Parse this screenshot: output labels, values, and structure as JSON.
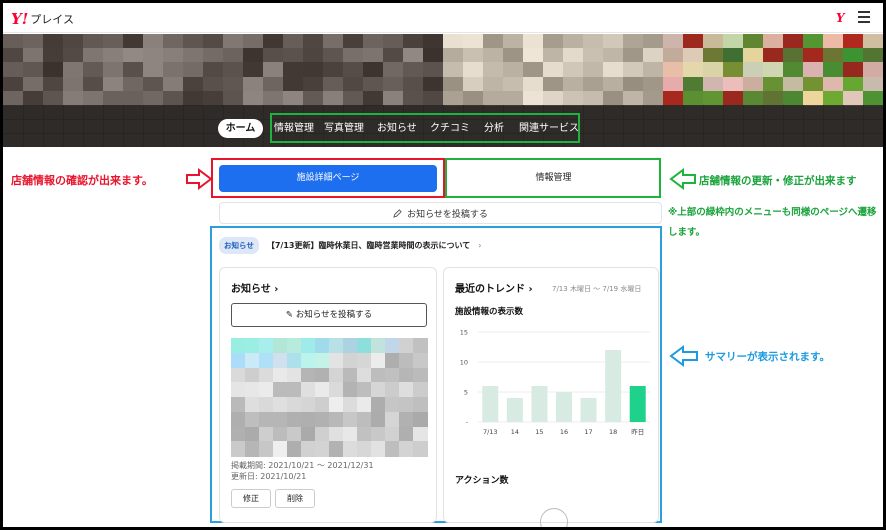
{
  "app": {
    "logo_mark": "Y!",
    "logo_name": "プレイス",
    "corner_logo": "Y"
  },
  "nav": {
    "home": "ホーム",
    "items": [
      "情報管理",
      "写真管理",
      "お知らせ",
      "クチコミ",
      "分析",
      "関連サービス"
    ]
  },
  "buttons": {
    "facility_page": "施設詳細ページ",
    "info_manage": "情報管理",
    "post_notice": "お知らせを投稿する"
  },
  "annotations": {
    "red_left": "店舗情報の確認が出来ます。",
    "green_right": "店舗情報の更新・修正が出来ます",
    "green_note": "※上部の緑枠内のメニューも同様のページへ遷移します。",
    "blue_right": "サマリーが表示されます。"
  },
  "notice": {
    "tag": "お知らせ",
    "title": "【7/13更新】臨時休業日、臨時営業時間の表示について",
    "chevron": "›"
  },
  "left_card": {
    "title": "お知らせ ›",
    "post_button": "お知らせを投稿する",
    "period": "掲載期間: 2021/10/21 ～ 2021/12/31",
    "updated": "更新日: 2021/10/21",
    "edit": "修正",
    "delete": "削除"
  },
  "right_card": {
    "title": "最近のトレンド ›",
    "date_range": "7/13 木曜日 ～ 7/19 水曜日",
    "chart_title": "施設情報の表示数",
    "action_title": "アクション数"
  },
  "colors": {
    "accent_blue": "#1e6ff0",
    "red": "#e8142d",
    "green": "#1db33d",
    "cyan": "#2a9fdc",
    "bar": "#d8ebe3",
    "bar_highlight": "#1fd28c"
  },
  "chart_data": {
    "type": "bar",
    "categories": [
      "7/13",
      "14",
      "15",
      "16",
      "17",
      "18",
      "昨日"
    ],
    "values": [
      6,
      4,
      6,
      5,
      4,
      12,
      6
    ],
    "ylim": [
      0,
      15
    ],
    "yticks": [
      "15",
      "10",
      "5",
      "-"
    ],
    "highlight_index": 6,
    "grid": true
  }
}
